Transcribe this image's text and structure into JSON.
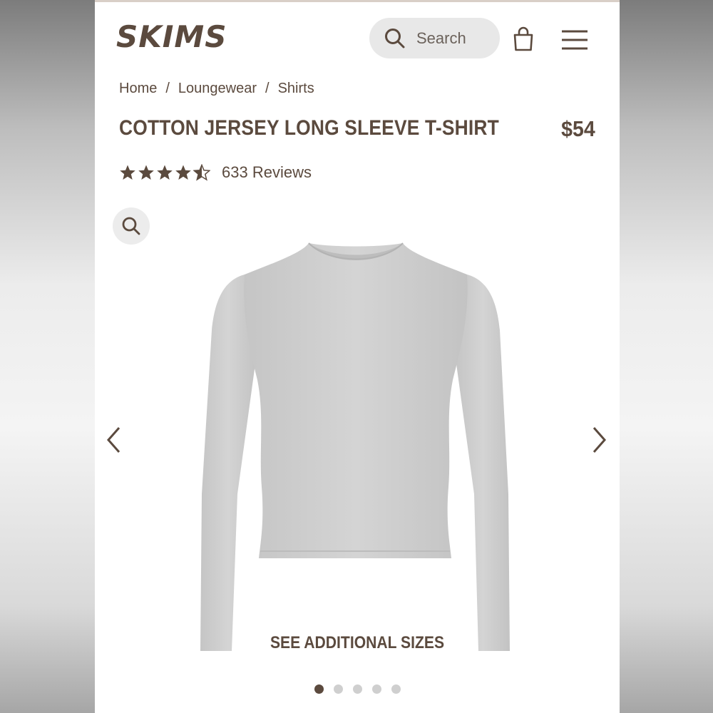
{
  "brand": {
    "logo_text": "SKIMS"
  },
  "header": {
    "search_label": "Search",
    "icons": [
      "search-icon",
      "shopping-bag-icon",
      "hamburger-menu-icon"
    ]
  },
  "breadcrumb": {
    "items": [
      "Home",
      "Loungewear",
      "Shirts"
    ],
    "separator": "/"
  },
  "product": {
    "title": "COTTON JERSEY LONG SLEEVE T-SHIRT",
    "price": "$54",
    "rating": 4.5,
    "reviews": "633 Reviews",
    "see_sizes": "SEE ADDITIONAL SIZES",
    "image_color": "#cfcfcf"
  },
  "carousel": {
    "total": 5,
    "active": 1
  },
  "colors": {
    "brand": "#5b4a3e",
    "search_bg": "#e8e8e8"
  }
}
